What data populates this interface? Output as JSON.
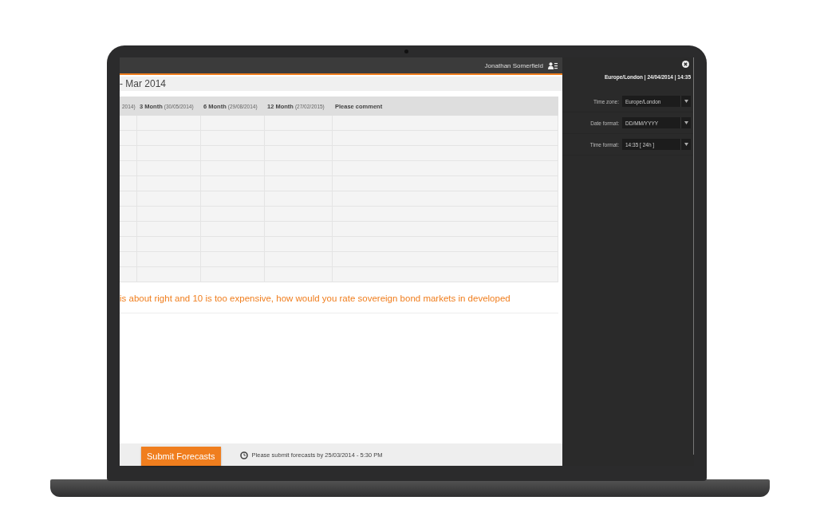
{
  "header": {
    "user_name": "Jonathan Somerfield"
  },
  "page_title": "- Mar 2014",
  "table": {
    "columns": [
      {
        "date": "2014)"
      },
      {
        "label": "3 Month",
        "date": "(30/05/2014)"
      },
      {
        "label": "6 Month",
        "date": "(29/08/2014)"
      },
      {
        "label": "12 Month",
        "date": "(27/02/2015)"
      },
      {
        "label": "Please comment"
      }
    ]
  },
  "question": "is about right and 10 is too expensive, how would you rate sovereign bond markets in developed",
  "footer": {
    "submit_button": "Submit Forecasts",
    "deadline": "Please submit forecasts by 25/03/2014 - 5:30 PM"
  },
  "settings_panel": {
    "summary": "Europe/London | 24/04/2014 | 14:35",
    "fields": [
      {
        "label": "Time zone:",
        "value": "Europe/London"
      },
      {
        "label": "Date format:",
        "value": "DD/MM/YYYY"
      },
      {
        "label": "Time format:",
        "value": "14:35 [ 24h ]"
      }
    ]
  }
}
